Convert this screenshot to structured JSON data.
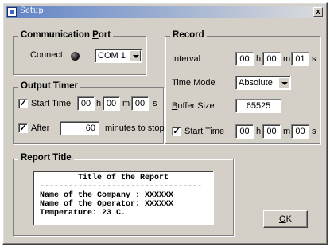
{
  "window": {
    "title": "Setup",
    "close_glyph": "x"
  },
  "comm_port": {
    "title_pre": "Communication ",
    "title_acc": "P",
    "title_post": "ort",
    "connect_label": "Connect",
    "port_value": "COM 1"
  },
  "output_timer": {
    "title": "Output Timer",
    "start_time": {
      "checked": true,
      "label": "Start Time",
      "h": "00",
      "m": "00",
      "s": "00"
    },
    "after": {
      "checked": true,
      "label": "After",
      "value": "60",
      "suffix": "minutes to stop"
    }
  },
  "record": {
    "title": "Record",
    "interval_label": "Interval",
    "interval": {
      "h": "00",
      "m": "00",
      "s": "01"
    },
    "time_mode_label": "Time Mode",
    "time_mode_value": "Absolute",
    "buffer_label_acc": "B",
    "buffer_label_rest": "uffer Size",
    "buffer_value": "65525",
    "start_time": {
      "checked": true,
      "label": "Start Time",
      "h": "00",
      "m": "00",
      "s": "00"
    }
  },
  "units": {
    "h": "h",
    "m": "m",
    "s": "s"
  },
  "report": {
    "title": "Report Title",
    "heading": "Title of the Report",
    "rule": "----------------------------------",
    "lines": [
      "Name of the Company : XXXXXX",
      "Name of the Operator: XXXXXX",
      "Temperature: 23 C."
    ]
  },
  "ok_button": {
    "acc": "O",
    "rest": "K"
  },
  "check_glyph": "✓",
  "colors": {
    "titlebar_start": "#5f83c7",
    "face": "#d4d0c8"
  }
}
